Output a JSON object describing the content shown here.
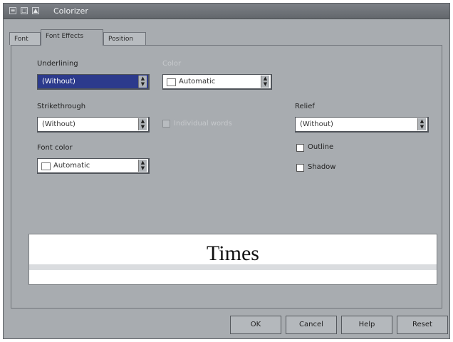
{
  "window": {
    "title": "Colorizer",
    "titlebar_icons": [
      "≡",
      "□",
      "▲"
    ]
  },
  "tabs": [
    {
      "label": "Font"
    },
    {
      "label": "Font Effects"
    },
    {
      "label": "Position"
    }
  ],
  "left": {
    "underline_label": "Underlining",
    "underline_value": "(Without)",
    "strike_label": "Strikethrough",
    "strike_value": "(Without)",
    "fontcolor_label": "Font color",
    "fontcolor_value": "Automatic",
    "spin_up": "▲",
    "spin_down": "▼"
  },
  "middle": {
    "color_label": "Color",
    "color_value": "Automatic",
    "individual_words_label": "Individual words"
  },
  "right": {
    "relief_label": "Relief",
    "relief_value": "(Without)",
    "outline_label": "Outline",
    "shadow_label": "Shadow"
  },
  "preview": {
    "sample": "Times"
  },
  "buttons": {
    "ok": "OK",
    "cancel": "Cancel",
    "help": "Help",
    "reset": "Reset"
  }
}
